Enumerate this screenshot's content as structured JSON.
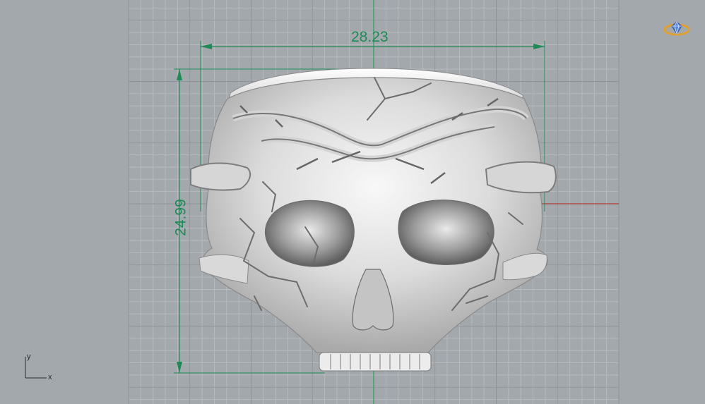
{
  "viewport": {
    "background": "#a3a8ad",
    "grid_minor_color": "#b7bbbf",
    "grid_major_color": "#8e9399"
  },
  "dimensions": {
    "width_label": "28.23",
    "height_label": "24.99",
    "color": "#1f8a55"
  },
  "axes": {
    "x_axis_color": "#b03a3a",
    "y_axis_color": "#27a35a",
    "x_label": "x",
    "y_label": "y"
  },
  "model": {
    "icon": "skull-ring-model"
  },
  "widget": {
    "icon": "gem-ring-icon",
    "color": "#e0a030"
  }
}
